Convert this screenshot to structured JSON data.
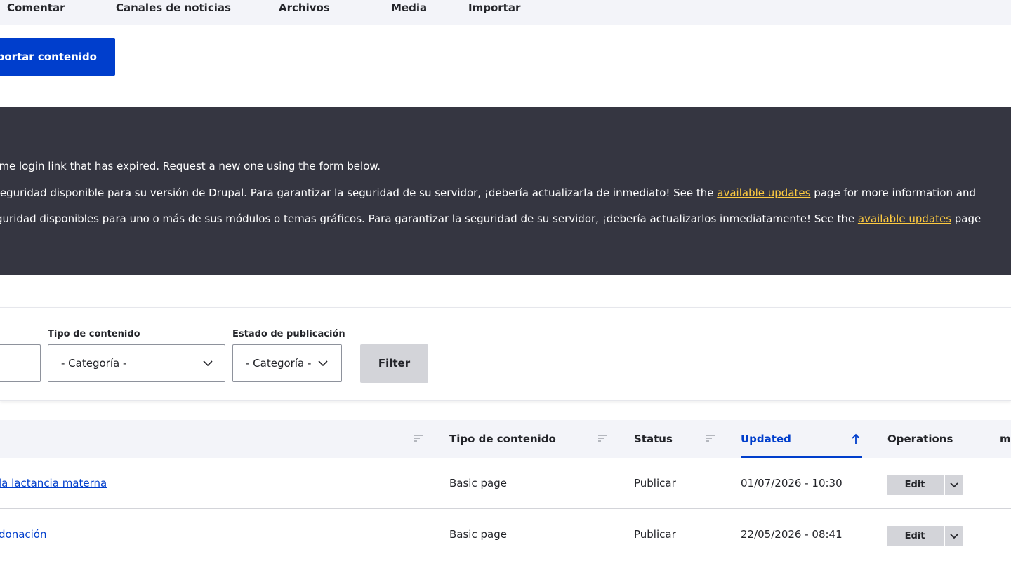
{
  "tabs": [
    {
      "label": "Comentar"
    },
    {
      "label": "Canales de noticias"
    },
    {
      "label": "Archivos"
    },
    {
      "label": "Media"
    },
    {
      "label": "Importar"
    }
  ],
  "actions": {
    "import_label": "Importar contenido"
  },
  "messages": {
    "m1": "one-time login link that has expired. Request a new one using the form below.",
    "m2_before": "seguridad disponible para su versión de Drupal. Para garantizar la seguridad de su servidor, ¡debería actualizarla de inmediato! See the ",
    "m2_link": "available updates",
    "m2_after": " page for more information and",
    "m3_before": "guridad disponibles para uno o más de sus módulos o temas gráficos. Para garantizar la seguridad de su servidor, ¡debería actualizarlos inmediatamente! See the ",
    "m3_link": "available updates",
    "m3_after": " page"
  },
  "filters": {
    "type_label": "Tipo de contenido",
    "type_value": "- Categoría -",
    "status_label": "Estado de publicación",
    "status_value": "- Categoría -",
    "submit_label": "Filter"
  },
  "table": {
    "columns": {
      "type": "Tipo de contenido",
      "status": "Status",
      "updated": "Updated",
      "operations": "Operations",
      "extra": "m"
    },
    "rows": [
      {
        "title": "la lactancia materna",
        "type": "Basic page",
        "status": "Publicar",
        "updated": "01/07/2026 - 10:30",
        "op": "Edit"
      },
      {
        "title": "donación",
        "type": "Basic page",
        "status": "Publicar",
        "updated": "22/05/2026 - 08:41",
        "op": "Edit"
      }
    ]
  },
  "colors": {
    "primary": "#003ecc",
    "message_bg": "#353641",
    "link_warning": "#fdca40"
  },
  "icons": [
    "chevron-down-icon",
    "sort-icon",
    "arrow-up-icon"
  ]
}
